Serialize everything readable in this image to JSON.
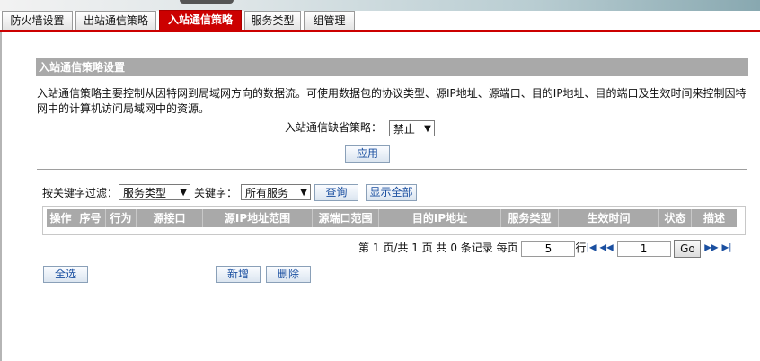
{
  "tabs": [
    {
      "label": "防火墙设置"
    },
    {
      "label": "出站通信策略"
    },
    {
      "label": "入站通信策略"
    },
    {
      "label": "服务类型"
    },
    {
      "label": "组管理"
    }
  ],
  "active_tab": "入站通信策略",
  "section": {
    "title": "入站通信策略设置",
    "description": "入站通信策略主要控制从因特网到局域网方向的数据流。可使用数据包的协议类型、源IP地址、源端口、目的IP地址、目的端口及生效时间来控制因特网中的计算机访问局域网中的资源。"
  },
  "default_policy": {
    "label": "入站通信缺省策略：",
    "value": "禁止"
  },
  "apply_label": "应用",
  "filter": {
    "label": "按关键字过滤：",
    "field_value": "服务类型",
    "keyword_label": "关键字：",
    "keyword_value": "所有服务",
    "query_label": "查询",
    "show_all_label": "显示全部"
  },
  "table": {
    "columns": [
      "操作",
      "序号",
      "行为",
      "源接口",
      "源IP地址范围",
      "源端口范围",
      "目的IP地址",
      "服务类型",
      "生效时间",
      "状态",
      "描述"
    ]
  },
  "pager": {
    "page_label": "第",
    "current_page": "1",
    "page_unit": "页/共",
    "total_pages": "1",
    "total_unit": "页 共",
    "total_records": "0",
    "records_unit": "条记录 每页",
    "per_page": "5",
    "row_unit": "行",
    "goto_value": "1",
    "go_label": "Go"
  },
  "actions": {
    "select_all": "全选",
    "add": "新增",
    "delete": "删除"
  }
}
